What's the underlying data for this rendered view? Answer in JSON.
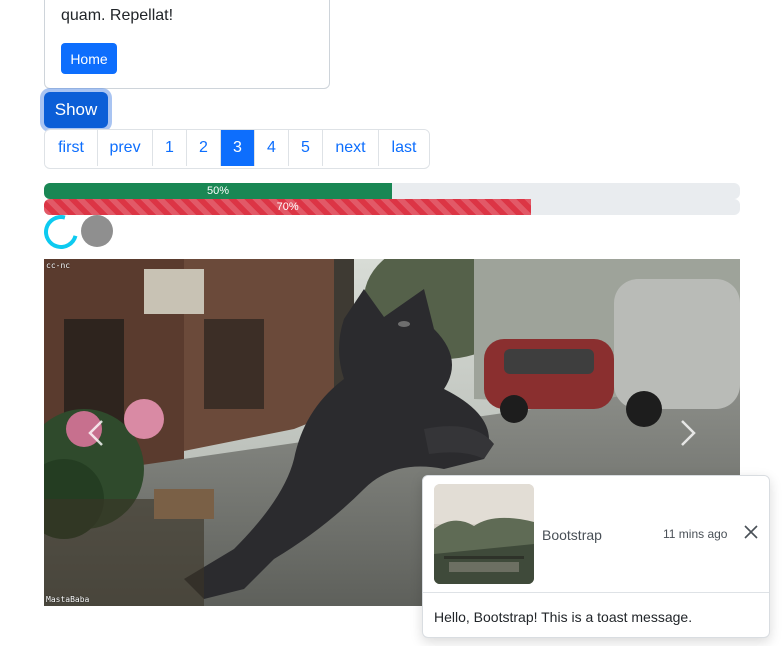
{
  "card": {
    "text": "quam. Repellat!",
    "home_label": "Home"
  },
  "show_button": {
    "label": "Show"
  },
  "pagination": {
    "items": [
      "first",
      "prev",
      "1",
      "2",
      "3",
      "4",
      "5",
      "next",
      "last"
    ],
    "active": "3"
  },
  "progress": [
    {
      "value": 50,
      "label": "50%",
      "color": "#198754",
      "striped": false
    },
    {
      "value": 70,
      "label": "70%",
      "color": "#dc3545",
      "striped": true
    }
  ],
  "spinners": {
    "border_color": "#0dcaf0",
    "grow_color": "#8f8f8f"
  },
  "carousel": {
    "watermark_top": "cc-nc",
    "watermark_bottom": "MastaBaba",
    "prev_icon": "chevron-left-icon",
    "next_icon": "chevron-right-icon"
  },
  "toast": {
    "title": "Bootstrap",
    "time": "11 mins ago",
    "body": "Hello, Bootstrap! This is a toast message.",
    "close_icon": "close-icon"
  },
  "colors": {
    "primary": "#0d6efd",
    "success": "#198754",
    "danger": "#dc3545",
    "info": "#0dcaf0"
  }
}
